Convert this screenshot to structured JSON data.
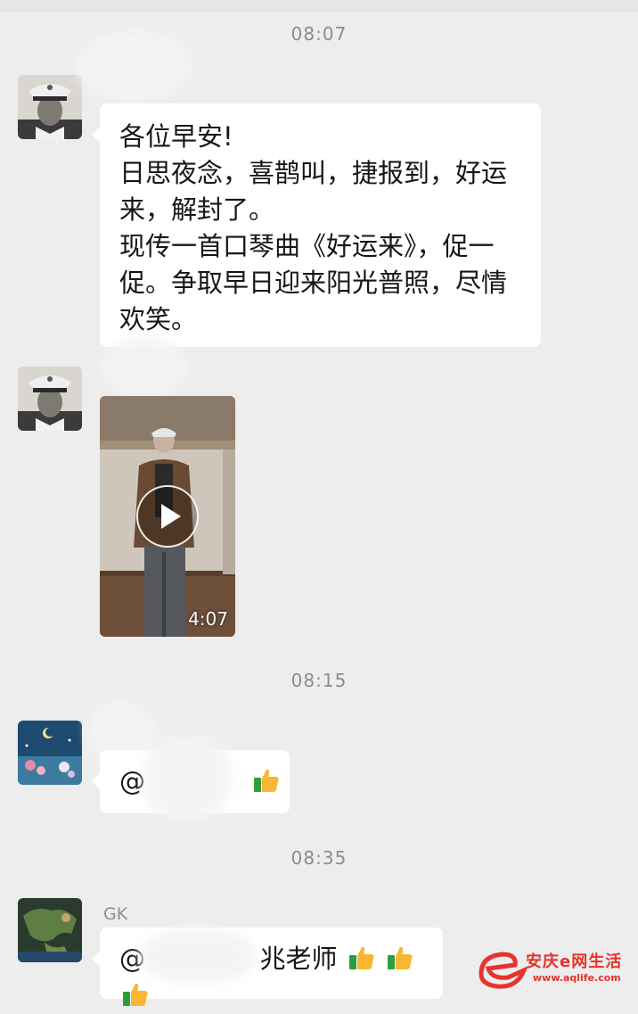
{
  "messages": {
    "time1": "08:07",
    "msg1_lines": [
      "各位早安!",
      "日思夜念，喜鹊叫，捷报到，好运",
      "来，解封了。",
      "现传一首口琴曲《好运来》，促一",
      "促。争取早日迎来阳光普照，尽情",
      "欢笑。"
    ],
    "video_duration": "4:07",
    "time2": "08:15",
    "msg3_prefix": "@",
    "time3": "08:35",
    "sender4": "GK",
    "msg4_prefix": "@",
    "msg4_suffix": "兆老师"
  },
  "watermark": {
    "brand": "安庆e网生活",
    "url": "www.aqlife.com"
  },
  "icons": {
    "avatar1": "uniformed-man-avatar-icon",
    "avatar2": "night-scene-avatar-icon",
    "avatar3": "earth-map-avatar-icon",
    "thumbs_up": "thumbs-up-emoji-icon",
    "play": "play-icon"
  }
}
